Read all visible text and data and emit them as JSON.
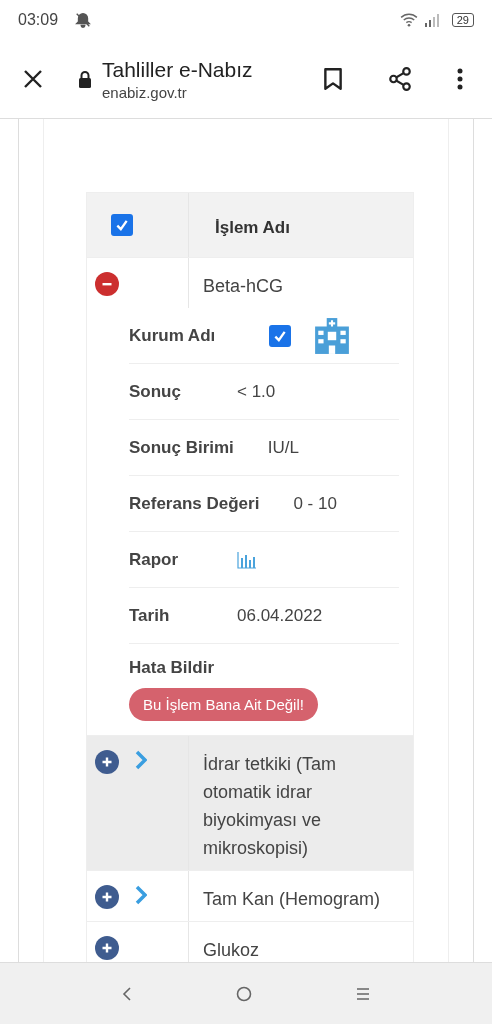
{
  "status_bar": {
    "time": "03:09",
    "battery": "29"
  },
  "browser": {
    "title": "Tahliller e-Nabız",
    "url": "enabiz.gov.tr"
  },
  "table": {
    "header": {
      "checked": true,
      "label": "İşlem Adı"
    },
    "rows": [
      {
        "name": "Beta-hCG",
        "expanded": true,
        "has_chevron": false,
        "shaded": false,
        "details": [
          {
            "kind": "institution",
            "label": "Kurum Adı",
            "checked": true
          },
          {
            "kind": "text",
            "label": "Sonuç",
            "value": "< 1.0"
          },
          {
            "kind": "text",
            "label": "Sonuç Birimi",
            "value": "IU/L"
          },
          {
            "kind": "text",
            "label": "Referans Değeri",
            "value": "0 - 10"
          },
          {
            "kind": "report",
            "label": "Rapor"
          },
          {
            "kind": "text",
            "label": "Tarih",
            "value": "06.04.2022"
          },
          {
            "kind": "action",
            "label": "Hata Bildir",
            "button": "Bu İşlem Bana Ait Değil!"
          }
        ]
      },
      {
        "name": "İdrar tetkiki (Tam otomatik idrar biyokimyası ve mikroskopisi)",
        "expanded": false,
        "has_chevron": true,
        "shaded": true
      },
      {
        "name": "Tam Kan (Hemogram)",
        "expanded": false,
        "has_chevron": true,
        "shaded": false
      },
      {
        "name": "Glukoz",
        "expanded": false,
        "has_chevron": false,
        "shaded": false
      }
    ]
  }
}
